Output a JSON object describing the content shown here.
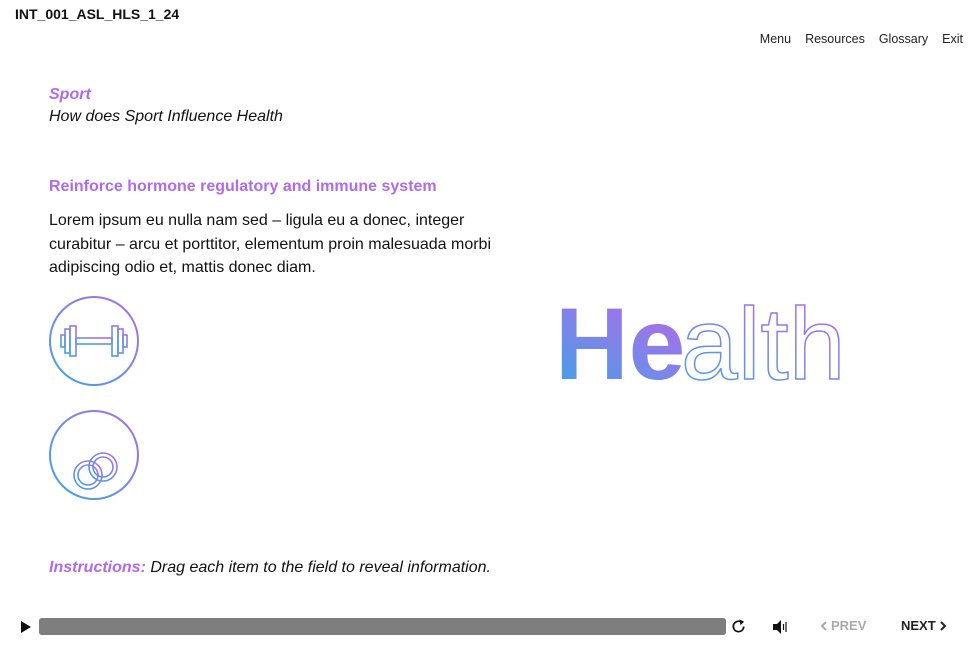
{
  "course_id": "INT_001_ASL_HLS_1_24",
  "nav": {
    "menu": "Menu",
    "resources": "Resources",
    "glossary": "Glossary",
    "exit": "Exit"
  },
  "module": {
    "title": "Sport",
    "subtitle": "How does Sport Influence Health"
  },
  "content": {
    "heading": "Reinforce hormone regulatory and immune system",
    "body": "Lorem ipsum eu nulla nam sed – ligula eu a donec, integer curabitur – arcu et porttitor, elementum proin malesuada morbi adipiscing odio et, mattis donec diam."
  },
  "drag_items": [
    {
      "icon": "barbell-icon"
    },
    {
      "icon": "gymnastic-rings-icon"
    }
  ],
  "health_word": {
    "filled": "He",
    "outlined": "alth"
  },
  "instructions": {
    "label": "Instructions:",
    "text": " Drag each item to the field to reveal information."
  },
  "player": {
    "progress": 1.0,
    "prev_label": "PREV",
    "next_label": "NEXT",
    "prev_enabled": false
  },
  "colors": {
    "accent_purple": "#b06be8",
    "accent_blue": "#3aa6e8"
  }
}
